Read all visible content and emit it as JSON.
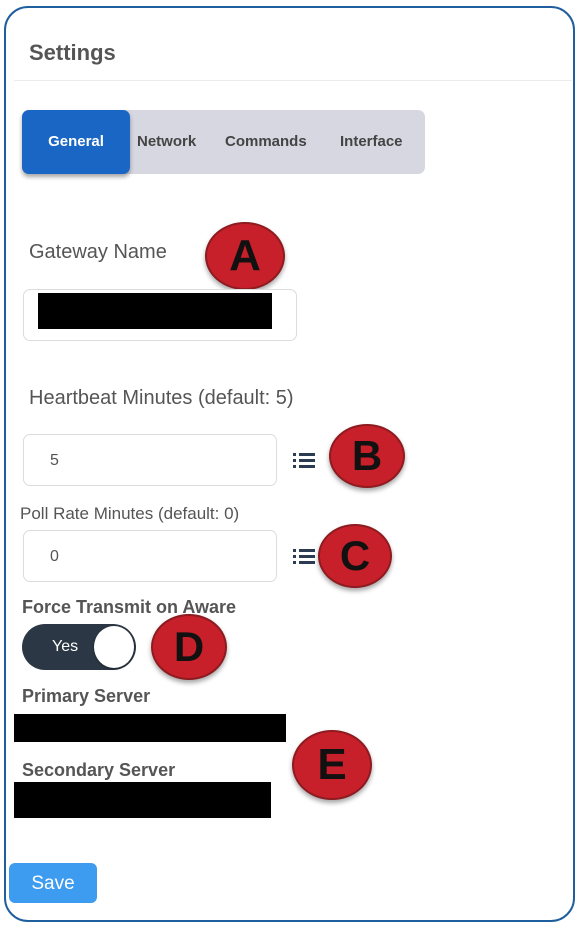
{
  "panel": {
    "title": "Settings"
  },
  "tabs": [
    {
      "label": "General",
      "active": true
    },
    {
      "label": "Network",
      "active": false
    },
    {
      "label": "Commands",
      "active": false
    },
    {
      "label": "Interface",
      "active": false
    }
  ],
  "fields": {
    "gateway_name": {
      "label": "Gateway Name",
      "value": ""
    },
    "heartbeat": {
      "label": "Heartbeat Minutes (default: 5)",
      "value": "5"
    },
    "poll_rate": {
      "label": "Poll Rate Minutes (default: 0)",
      "value": "0"
    },
    "force_transmit": {
      "label": "Force Transmit on Aware",
      "toggle_label": "Yes",
      "on": true
    },
    "primary_server": {
      "label": "Primary Server"
    },
    "secondary_server": {
      "label": "Secondary Server"
    }
  },
  "callouts": [
    "A",
    "B",
    "C",
    "D",
    "E"
  ],
  "actions": {
    "save_label": "Save"
  },
  "colors": {
    "accent": "#1a66c4",
    "save": "#3d9bf0",
    "callout": "#c8202a",
    "toggle": "#2b3744",
    "frame": "#1f5f9e"
  },
  "icons": {
    "options": "list-icon"
  }
}
